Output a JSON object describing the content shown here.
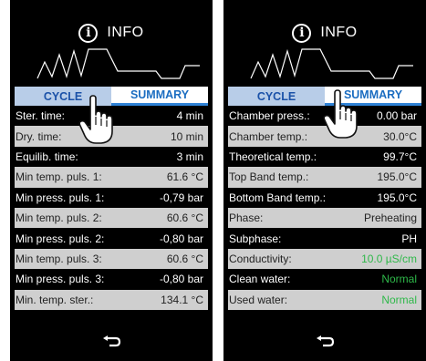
{
  "left": {
    "header_title": "INFO",
    "tabs": [
      {
        "label": "CYCLE"
      },
      {
        "label": "SUMMARY"
      }
    ],
    "rows": [
      {
        "label": "Ster. time:",
        "value": "4 min"
      },
      {
        "label": "Dry. time:",
        "value": "10 min"
      },
      {
        "label": "Equilib. time:",
        "value": "3 min"
      },
      {
        "label": "Min temp. puls. 1:",
        "value": "61.6 °C"
      },
      {
        "label": "Min press. puls. 1:",
        "value": "-0,79 bar"
      },
      {
        "label": "Min temp. puls. 2:",
        "value": "60.6 °C"
      },
      {
        "label": "Min press. puls. 2:",
        "value": "-0,80 bar"
      },
      {
        "label": "Min temp. puls. 3:",
        "value": "60.6 °C"
      },
      {
        "label": "Min press. puls. 3:",
        "value": "-0,80 bar"
      },
      {
        "label": "Min. temp. ster.:",
        "value": "134.1 °C"
      }
    ]
  },
  "right": {
    "header_title": "INFO",
    "tabs": [
      {
        "label": "CYCLE"
      },
      {
        "label": "SUMMARY"
      }
    ],
    "rows": [
      {
        "label": "Chamber press.:",
        "value": "0.00 bar"
      },
      {
        "label": "Chamber temp.:",
        "value": "30.0°C"
      },
      {
        "label": "Theoretical temp.:",
        "value": "99.7°C"
      },
      {
        "label": "Top Band temp.:",
        "value": "195.0°C"
      },
      {
        "label": "Bottom Band temp.:",
        "value": "195.0°C"
      },
      {
        "label": "Phase:",
        "value": "Preheating"
      },
      {
        "label": "Subphase:",
        "value": "PH"
      },
      {
        "label": "Conductivity:",
        "value": "10.0 µS/cm"
      },
      {
        "label": "Clean water:",
        "value": "Normal"
      },
      {
        "label": "Used water:",
        "value": "Normal"
      }
    ]
  },
  "colors": {
    "accent_blue": "#1b6dc1",
    "active_tab_bg": "#b8cde8",
    "status_green": "#2fb84a",
    "row_light": "#cfcfcf"
  },
  "icons": {
    "info": "info-circle-icon",
    "back": "back-arrow-icon",
    "hand": "pointing-hand-icon"
  }
}
